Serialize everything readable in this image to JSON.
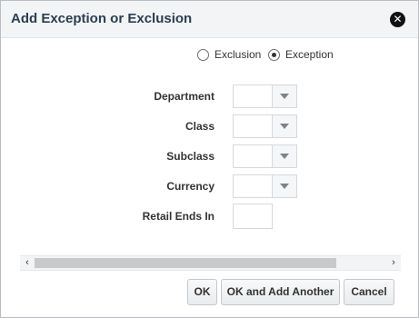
{
  "dialog": {
    "title": "Add Exception or Exclusion",
    "close_icon": "close-icon"
  },
  "type_options": [
    {
      "label": "Exclusion",
      "checked": false
    },
    {
      "label": "Exception",
      "checked": true
    }
  ],
  "fields": {
    "department": {
      "label": "Department",
      "value": ""
    },
    "class": {
      "label": "Class",
      "value": ""
    },
    "subclass": {
      "label": "Subclass",
      "value": ""
    },
    "currency": {
      "label": "Currency",
      "value": ""
    },
    "retail_ends_in": {
      "label": "Retail Ends In",
      "value": ""
    }
  },
  "scrollbar": {
    "left_icon": "chevron-left-icon",
    "right_icon": "chevron-right-icon",
    "left_glyph": "‹",
    "right_glyph": "›"
  },
  "buttons": {
    "ok": "OK",
    "ok_add_another": "OK and Add Another",
    "cancel": "Cancel"
  },
  "close_glyph": "✕"
}
